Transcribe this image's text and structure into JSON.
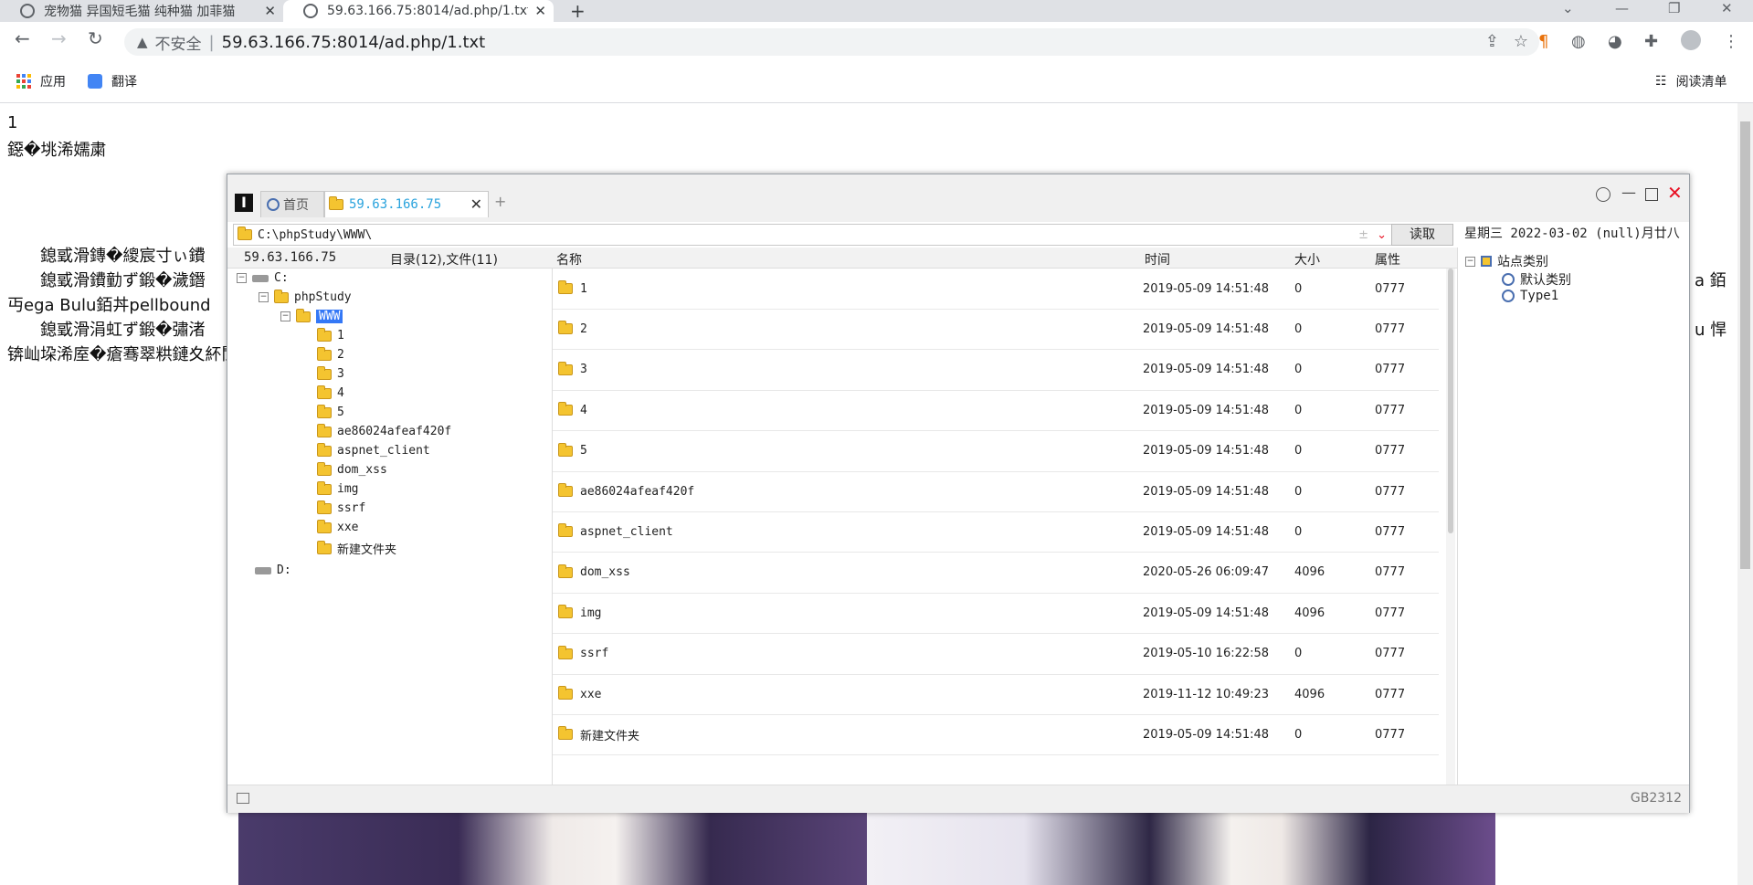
{
  "browser": {
    "tabs": [
      {
        "title": "宠物猫 异国短毛猫 纯种猫 加菲猫"
      },
      {
        "title": "59.63.166.75:8014/ad.php/1.txt"
      }
    ],
    "address": {
      "insecure_label": "不安全",
      "url": "59.63.166.75:8014/ad.php/1.txt"
    },
    "bookmarks": {
      "apps": "应用",
      "translate": "翻译",
      "reading_list": "阅读清单"
    }
  },
  "page": {
    "lines": [
      "1",
      "鐚�垗浠嬬粛",
      "　　鎴戜滑鏄�繌宸寸ぃ鐨",
      "　　鎴戜滑鐨勭ず鍛�濊鐕",
      "丏ega Bulu銆丼pellbound",
      "　　鎴戜滑涓虹ず鍛�彇渚",
      "锛屾垜浠庢�瘡骞翠粠鏈夊紑閬",
      "a 銆",
      "u 悍"
    ]
  },
  "app": {
    "tabs": {
      "home": "首页",
      "site": "59.63.166.75"
    },
    "path": "C:\\phpStudy\\WWW\\",
    "read_button": "读取",
    "date": "星期三 2022-03-02 (null)月廿八",
    "info": {
      "host": "59.63.166.75",
      "summary": "目录(12),文件(11)"
    },
    "columns": {
      "name": "名称",
      "time": "时间",
      "size": "大小",
      "attr": "属性"
    },
    "tree": {
      "drive_c": "C:",
      "phpstudy": "phpStudy",
      "www": "WWW",
      "children": [
        "1",
        "2",
        "3",
        "4",
        "5",
        "ae86024afeaf420f",
        "aspnet_client",
        "dom_xss",
        "img",
        "ssrf",
        "xxe",
        "新建文件夹"
      ],
      "drive_d": "D:"
    },
    "files": [
      {
        "name": "1",
        "time": "2019-05-09 14:51:48",
        "size": "0",
        "attr": "0777"
      },
      {
        "name": "2",
        "time": "2019-05-09 14:51:48",
        "size": "0",
        "attr": "0777"
      },
      {
        "name": "3",
        "time": "2019-05-09 14:51:48",
        "size": "0",
        "attr": "0777"
      },
      {
        "name": "4",
        "time": "2019-05-09 14:51:48",
        "size": "0",
        "attr": "0777"
      },
      {
        "name": "5",
        "time": "2019-05-09 14:51:48",
        "size": "0",
        "attr": "0777"
      },
      {
        "name": "ae86024afeaf420f",
        "time": "2019-05-09 14:51:48",
        "size": "0",
        "attr": "0777"
      },
      {
        "name": "aspnet_client",
        "time": "2019-05-09 14:51:48",
        "size": "0",
        "attr": "0777"
      },
      {
        "name": "dom_xss",
        "time": "2020-05-26 06:09:47",
        "size": "4096",
        "attr": "0777"
      },
      {
        "name": "img",
        "time": "2019-05-09 14:51:48",
        "size": "4096",
        "attr": "0777"
      },
      {
        "name": "ssrf",
        "time": "2019-05-10 16:22:58",
        "size": "0",
        "attr": "0777"
      },
      {
        "name": "xxe",
        "time": "2019-11-12 10:49:23",
        "size": "4096",
        "attr": "0777"
      },
      {
        "name": "新建文件夹",
        "time": "2019-05-09 14:51:48",
        "size": "0",
        "attr": "0777"
      }
    ],
    "categories": {
      "root": "站点类别",
      "items": [
        "默认类别",
        "Type1"
      ]
    },
    "encoding": "GB2312"
  },
  "icons": [
    "back-icon",
    "forward-icon",
    "reload-icon",
    "warning-icon",
    "share-icon",
    "star-icon",
    "puzzle-icon",
    "profile-icon",
    "more-icon",
    "folder-icon",
    "drive-icon"
  ],
  "colors": {
    "accent": "#3478f6",
    "tab_active_text": "#2aa3dd",
    "close_red": "#e81123",
    "folder": "#f4c430"
  }
}
